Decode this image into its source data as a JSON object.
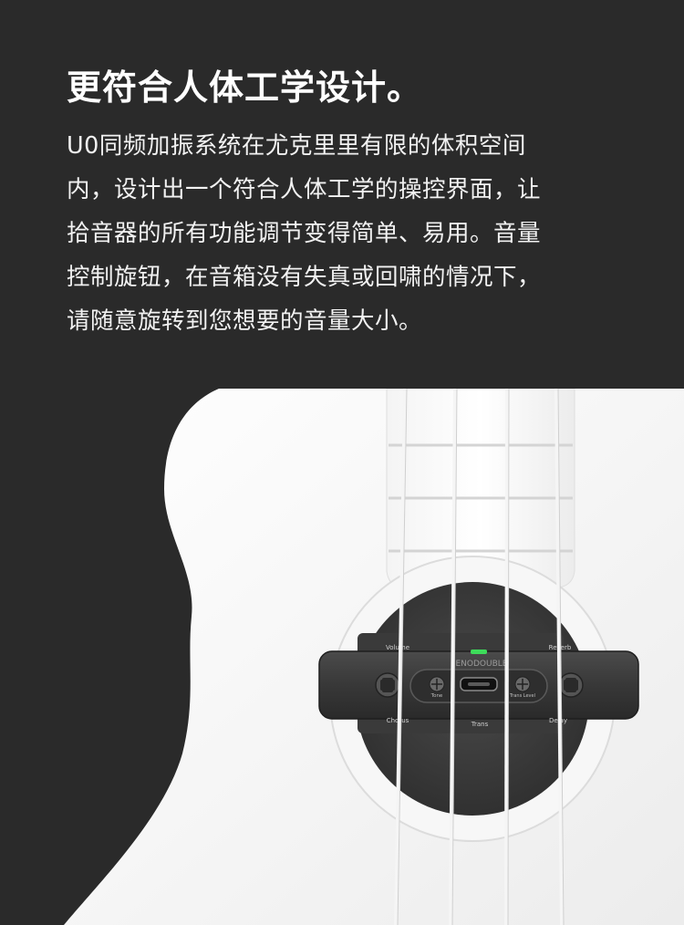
{
  "headline": "更符合人体工学设计。",
  "body_lines": [
    "U0同频加振系统在尤克里里有限的体积空间",
    "内，设计出一个符合人体工学的操控界面，让",
    "拾音器的所有功能调节变得简单、易用。音量",
    "控制旋钮，在音箱没有失真或回啸的情况下，",
    "请随意旋转到您想要的音量大小。"
  ],
  "pickup": {
    "brand": "ENODOUBLE",
    "knobs": {
      "volume": "Volume",
      "reverb": "Reverb",
      "chorus": "Chorus",
      "delay": "Delay",
      "tone": "Tone",
      "trans_level": "Trans Level",
      "trans": "Trans"
    },
    "indicator_color": "#3ddc5a"
  }
}
